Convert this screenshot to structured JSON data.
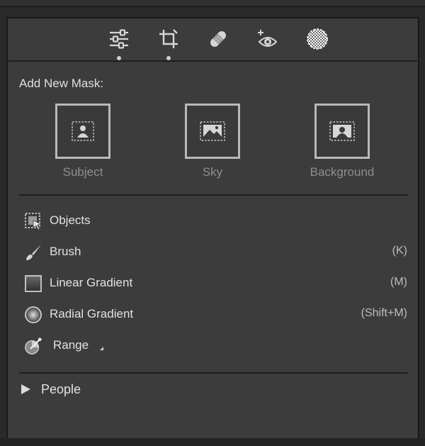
{
  "toolbar": {
    "tools": [
      {
        "name": "sliders-icon",
        "active_dot": true
      },
      {
        "name": "crop-icon",
        "active_dot": true
      },
      {
        "name": "bandage-icon",
        "active_dot": false
      },
      {
        "name": "red-eye-icon",
        "active_dot": false
      },
      {
        "name": "masking-icon",
        "active_dot": false
      }
    ]
  },
  "add_new_mask": {
    "heading": "Add New Mask:",
    "buttons": [
      {
        "label": "Subject",
        "icon": "subject-icon"
      },
      {
        "label": "Sky",
        "icon": "sky-icon"
      },
      {
        "label": "Background",
        "icon": "background-icon"
      }
    ]
  },
  "mask_tools": [
    {
      "label": "Objects",
      "shortcut": "",
      "icon": "objects-icon"
    },
    {
      "label": "Brush",
      "shortcut": "(K)",
      "icon": "brush-icon"
    },
    {
      "label": "Linear Gradient",
      "shortcut": "(M)",
      "icon": "linear-gradient-icon"
    },
    {
      "label": "Radial Gradient",
      "shortcut": "(Shift+M)",
      "icon": "radial-gradient-icon"
    },
    {
      "label": "Range",
      "shortcut": "",
      "icon": "range-icon"
    }
  ],
  "people": {
    "label": "People"
  },
  "colors": {
    "panel": "#3c3c3c",
    "text": "#e2e2e2",
    "muted": "#8f8f8f",
    "border": "#b9b9b9"
  }
}
